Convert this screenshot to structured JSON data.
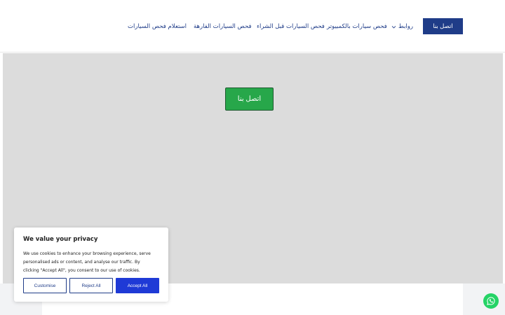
{
  "header": {
    "cta_label": "اتصل بنا",
    "nav": {
      "links_label": "روابط",
      "computer_check": "فحص سيارات بالكمبيوتر",
      "pre_purchase_check": "فحص السيارات قبل الشراء",
      "luxury_check": "فحص السيارات الفارهة",
      "inquiry_check": "استعلام فحص السيارات"
    }
  },
  "hero": {
    "cta_label": "اتصل بنا"
  },
  "cookie": {
    "title": "We value your privacy",
    "text": "We use cookies to enhance your browsing experience, serve personalised ads or content, and analyse our traffic. By clicking \"Accept All\", you consent to our use of cookies.",
    "customise": "Customise",
    "reject": "Reject All",
    "accept": "Accept All"
  },
  "colors": {
    "brand_blue": "#1f3c88",
    "accept_blue": "#1f3ad6",
    "hero_green": "#27a74a",
    "whatsapp_green": "#25d366",
    "hero_gray": "#dcdcdc"
  },
  "icons": {
    "dropdown": "chevron-down-icon",
    "whatsapp": "whatsapp-icon"
  }
}
